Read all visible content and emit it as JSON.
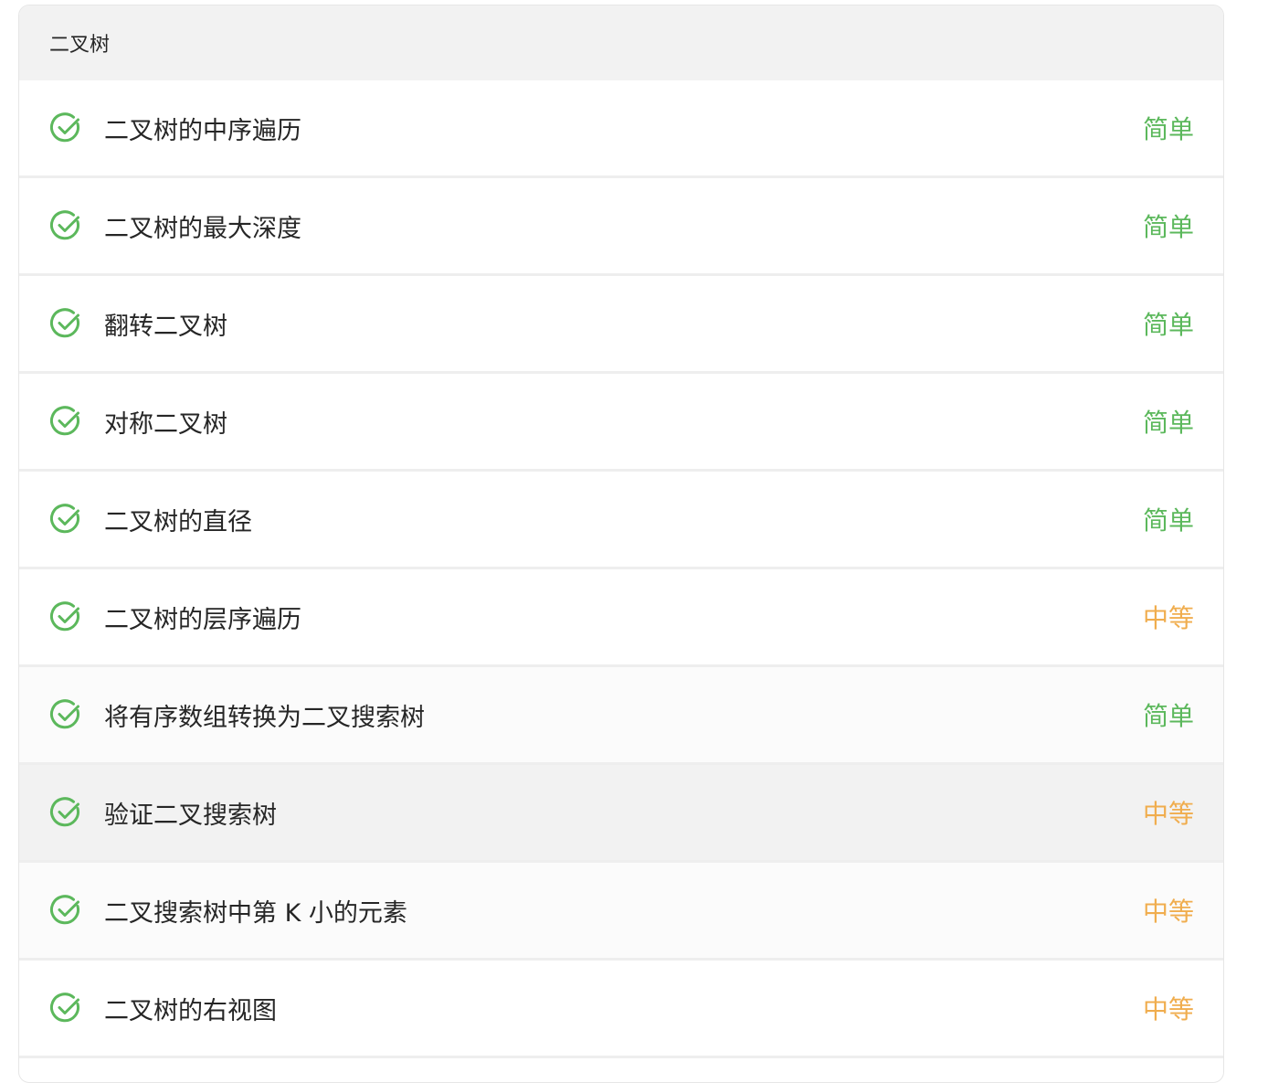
{
  "section": {
    "title": "二叉树"
  },
  "colors": {
    "check": "#5cb85c",
    "easy": "#5cb85c",
    "medium": "#f0ad4e"
  },
  "problems": [
    {
      "title": "二叉树的中序遍历",
      "difficulty": "简单",
      "level": "easy",
      "solved": true,
      "icon": "check-circle-icon"
    },
    {
      "title": "二叉树的最大深度",
      "difficulty": "简单",
      "level": "easy",
      "solved": true,
      "icon": "check-circle-icon"
    },
    {
      "title": "翻转二叉树",
      "difficulty": "简单",
      "level": "easy",
      "solved": true,
      "icon": "check-circle-icon"
    },
    {
      "title": "对称二叉树",
      "difficulty": "简单",
      "level": "easy",
      "solved": true,
      "icon": "check-circle-icon"
    },
    {
      "title": "二叉树的直径",
      "difficulty": "简单",
      "level": "easy",
      "solved": true,
      "icon": "check-circle-icon"
    },
    {
      "title": "二叉树的层序遍历",
      "difficulty": "中等",
      "level": "medium",
      "solved": true,
      "icon": "check-circle-icon"
    },
    {
      "title": "将有序数组转换为二叉搜索树",
      "difficulty": "简单",
      "level": "easy",
      "solved": true,
      "icon": "check-circle-icon"
    },
    {
      "title": "验证二叉搜索树",
      "difficulty": "中等",
      "level": "medium",
      "solved": true,
      "icon": "check-circle-icon"
    },
    {
      "title": "二叉搜索树中第 K 小的元素",
      "difficulty": "中等",
      "level": "medium",
      "solved": true,
      "icon": "check-circle-icon"
    },
    {
      "title": "二叉树的右视图",
      "difficulty": "中等",
      "level": "medium",
      "solved": true,
      "icon": "check-circle-icon"
    }
  ]
}
